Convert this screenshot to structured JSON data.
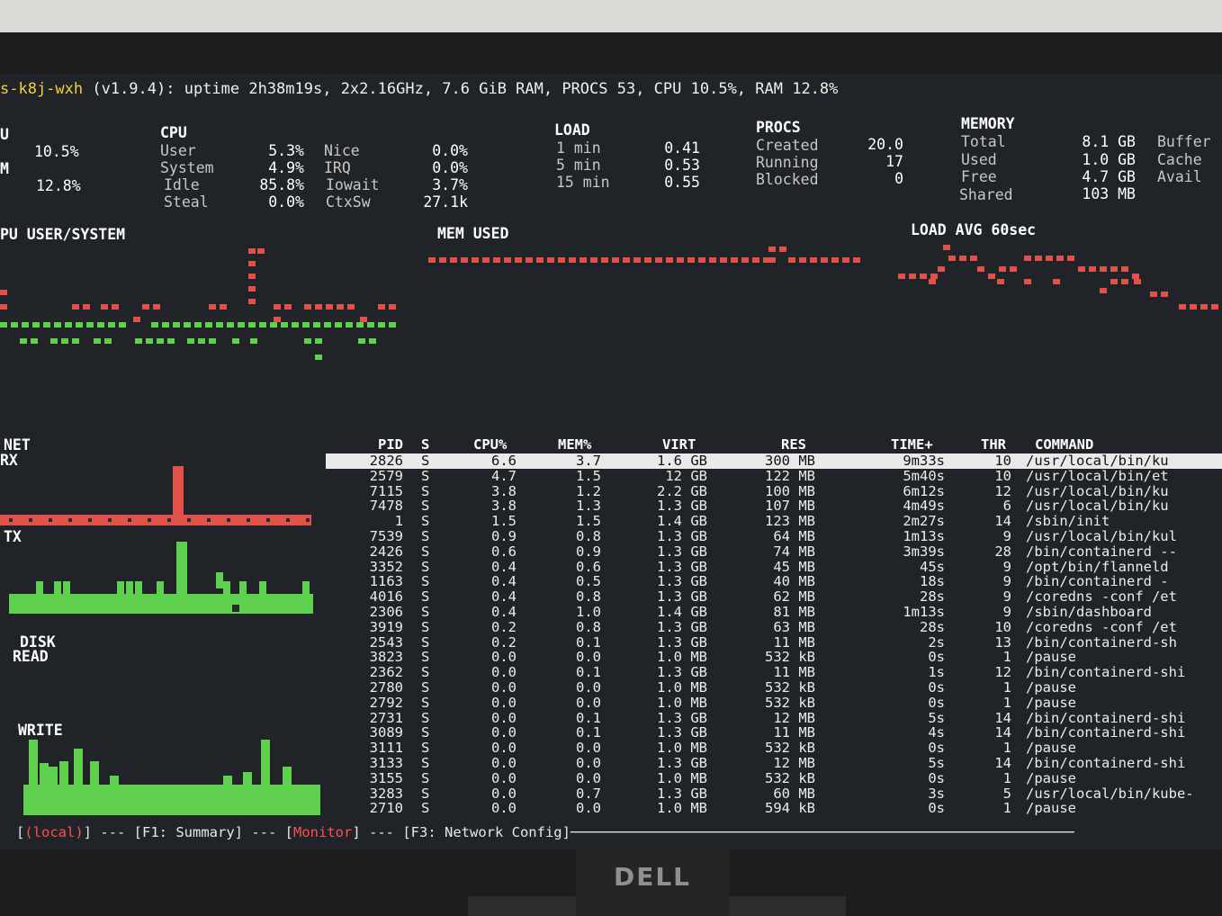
{
  "title_bar": {
    "host": "s-k8j-wxh",
    "rest": " (v1.9.4): uptime 2h38m19s, 2x2.16GHz, 7.6 GiB RAM, PROCS 53, CPU 10.5%, RAM 12.8%"
  },
  "quick": {
    "cpu_label": "U",
    "cpu_value": "10.5%",
    "mem_label": "M",
    "mem_value": "12.8%"
  },
  "cpu": {
    "header": "CPU",
    "rows": [
      {
        "l1": "User",
        "v1": "5.3%",
        "l2": "Nice",
        "v2": "0.0%"
      },
      {
        "l1": "System",
        "v1": "4.9%",
        "l2": "IRQ",
        "v2": "0.0%"
      },
      {
        "l1": "Idle",
        "v1": "85.8%",
        "l2": "Iowait",
        "v2": "3.7%"
      },
      {
        "l1": "Steal",
        "v1": "0.0%",
        "l2": "CtxSw",
        "v2": "27.1k"
      }
    ]
  },
  "load": {
    "header": "LOAD",
    "rows": [
      {
        "label": "1 min",
        "value": "0.41"
      },
      {
        "label": "5 min",
        "value": "0.53"
      },
      {
        "label": "15 min",
        "value": "0.55"
      }
    ]
  },
  "procs": {
    "header": "PROCS",
    "rows": [
      {
        "label": "Created",
        "value": "20.0"
      },
      {
        "label": "Running",
        "value": "17"
      },
      {
        "label": "Blocked",
        "value": "0"
      }
    ]
  },
  "memory": {
    "header": "MEMORY",
    "rows": [
      {
        "label": "Total",
        "value": "8.1 GB",
        "extra": "Buffer"
      },
      {
        "label": "Used",
        "value": "1.0 GB",
        "extra": "Cache"
      },
      {
        "label": "Free",
        "value": "4.7 GB",
        "extra": "Avail"
      },
      {
        "label": "Shared",
        "value": "103 MB",
        "extra": ""
      }
    ]
  },
  "graphs": {
    "cpu_title": "PU USER/SYSTEM",
    "mem_title": "MEM USED",
    "load_title": "LOAD AVG 60sec",
    "net_title": "NET",
    "rx_label": "RX",
    "tx_label": "TX",
    "disk_title": "DISK",
    "read_label": "READ",
    "write_label": "WRITE"
  },
  "process_table": {
    "columns": [
      "PID",
      "S",
      "CPU%",
      "MEM%",
      "VIRT",
      "RES",
      "TIME+",
      "THR",
      "COMMAND"
    ],
    "rows": [
      [
        "2826",
        "S",
        "6.6",
        "3.7",
        "1.6 GB",
        "300 MB",
        "9m33s",
        "10",
        "/usr/local/bin/ku"
      ],
      [
        "2579",
        "S",
        "4.7",
        "1.5",
        "12 GB",
        "122 MB",
        "5m40s",
        "10",
        "/usr/local/bin/et"
      ],
      [
        "7115",
        "S",
        "3.8",
        "1.2",
        "2.2 GB",
        "100 MB",
        "6m12s",
        "12",
        "/usr/local/bin/ku"
      ],
      [
        "7478",
        "S",
        "3.8",
        "1.3",
        "1.3 GB",
        "107 MB",
        "4m49s",
        "6",
        "/usr/local/bin/ku"
      ],
      [
        "1",
        "S",
        "1.5",
        "1.5",
        "1.4 GB",
        "123 MB",
        "2m27s",
        "14",
        "/sbin/init"
      ],
      [
        "7539",
        "S",
        "0.9",
        "0.8",
        "1.3 GB",
        "64 MB",
        "1m13s",
        "9",
        "/usr/local/bin/kul"
      ],
      [
        "2426",
        "S",
        "0.6",
        "0.9",
        "1.3 GB",
        "74 MB",
        "3m39s",
        "28",
        "/bin/containerd --"
      ],
      [
        "3352",
        "S",
        "0.4",
        "0.6",
        "1.3 GB",
        "45 MB",
        "45s",
        "9",
        "/opt/bin/flanneld"
      ],
      [
        "1163",
        "S",
        "0.4",
        "0.5",
        "1.3 GB",
        "40 MB",
        "18s",
        "9",
        "/bin/containerd -"
      ],
      [
        "4016",
        "S",
        "0.4",
        "0.8",
        "1.3 GB",
        "62 MB",
        "28s",
        "9",
        "/coredns -conf /et"
      ],
      [
        "2306",
        "S",
        "0.4",
        "1.0",
        "1.4 GB",
        "81 MB",
        "1m13s",
        "9",
        "/sbin/dashboard"
      ],
      [
        "3919",
        "S",
        "0.2",
        "0.8",
        "1.3 GB",
        "63 MB",
        "28s",
        "10",
        "/coredns -conf /et"
      ],
      [
        "2543",
        "S",
        "0.2",
        "0.1",
        "1.3 GB",
        "11 MB",
        "2s",
        "13",
        "/bin/containerd-sh"
      ],
      [
        "3823",
        "S",
        "0.0",
        "0.0",
        "1.0 MB",
        "532 kB",
        "0s",
        "1",
        "/pause"
      ],
      [
        "2362",
        "S",
        "0.0",
        "0.1",
        "1.3 GB",
        "11 MB",
        "1s",
        "12",
        "/bin/containerd-shi"
      ],
      [
        "2780",
        "S",
        "0.0",
        "0.0",
        "1.0 MB",
        "532 kB",
        "0s",
        "1",
        "/pause"
      ],
      [
        "2792",
        "S",
        "0.0",
        "0.0",
        "1.0 MB",
        "532 kB",
        "0s",
        "1",
        "/pause"
      ],
      [
        "2731",
        "S",
        "0.0",
        "0.1",
        "1.3 GB",
        "12 MB",
        "5s",
        "14",
        "/bin/containerd-shi"
      ],
      [
        "3089",
        "S",
        "0.0",
        "0.1",
        "1.3 GB",
        "11 MB",
        "4s",
        "14",
        "/bin/containerd-shi"
      ],
      [
        "3111",
        "S",
        "0.0",
        "0.0",
        "1.0 MB",
        "532 kB",
        "0s",
        "1",
        "/pause"
      ],
      [
        "3133",
        "S",
        "0.0",
        "0.0",
        "1.3 GB",
        "12 MB",
        "5s",
        "14",
        "/bin/containerd-shi"
      ],
      [
        "3155",
        "S",
        "0.0",
        "0.0",
        "1.0 MB",
        "532 kB",
        "0s",
        "1",
        "/pause"
      ],
      [
        "3283",
        "S",
        "0.0",
        "0.7",
        "1.3 GB",
        "60 MB",
        "3s",
        "5",
        "/usr/local/bin/kube-"
      ],
      [
        "2710",
        "S",
        "0.0",
        "0.0",
        "1.0 MB",
        "594 kB",
        "0s",
        "1",
        "/pause"
      ]
    ],
    "selected_row": 0
  },
  "footer": {
    "open1": "[",
    "tab_local": "(local)",
    "close1": "] --- ",
    "tab_summary": "[F1: Summary]",
    "sep2": " --- [",
    "tab_monitor": "Monitor",
    "close3": "] --- ",
    "tab_network": "[F3: Network Config]"
  },
  "monitor_brand": "DELL"
}
